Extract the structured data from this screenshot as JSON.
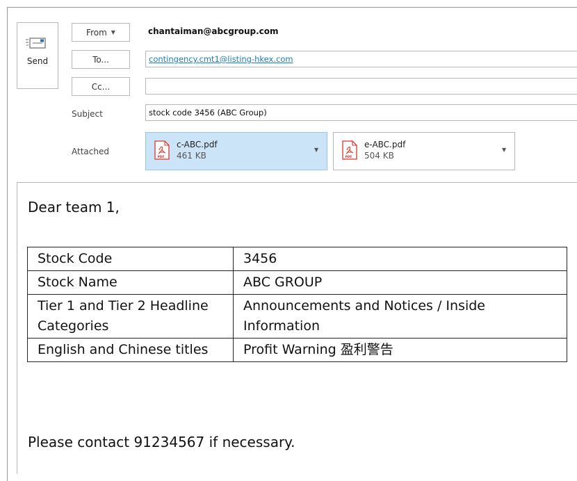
{
  "compose": {
    "send_label": "Send",
    "from_label": "From",
    "from_value": "chantaiman@abcgroup.com",
    "to_label": "To...",
    "to_value": "contingency.cmt1@listing-hkex.com",
    "cc_label": "Cc...",
    "cc_value": "",
    "subject_label": "Subject",
    "subject_value": "stock code 3456 (ABC Group)",
    "attached_label": "Attached",
    "attachments": [
      {
        "name": "c-ABC.pdf",
        "size": "461 KB",
        "icon": "pdf-icon",
        "selected": true
      },
      {
        "name": "e-ABC.pdf",
        "size": "504 KB",
        "icon": "pdf-icon",
        "selected": false
      }
    ]
  },
  "body": {
    "greeting": "Dear team 1,",
    "table": [
      {
        "key": "Stock Code",
        "value": "3456"
      },
      {
        "key": "Stock Name",
        "value": "ABC GROUP"
      },
      {
        "key": "Tier 1 and Tier 2 Headline Categories",
        "value": "Announcements and Notices / Inside Information"
      },
      {
        "key": "English and Chinese titles",
        "value": "Profit Warning 盈利警告"
      }
    ],
    "closing": "Please contact 91234567 if necessary."
  },
  "colors": {
    "accent_link": "#1a7fb5",
    "selected_attachment": "#cce4f7",
    "pdf_red": "#d9342b"
  }
}
